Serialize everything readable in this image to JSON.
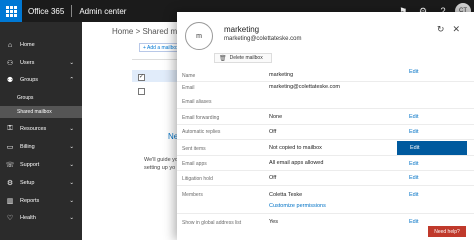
{
  "topbar": {
    "brand": "Office 365",
    "title": "Admin center",
    "icons": [
      "bell-icon",
      "gear-icon",
      "help-icon"
    ],
    "avatar_initials": "CT"
  },
  "sidebar": {
    "items": [
      {
        "icon": "home-icon",
        "glyph": "⌂",
        "label": "Home",
        "chevron": ""
      },
      {
        "icon": "users-icon",
        "glyph": "⚇",
        "label": "Users",
        "chevron": "⌄"
      },
      {
        "icon": "groups-icon",
        "glyph": "⚉",
        "label": "Groups",
        "chevron": "⌃"
      },
      {
        "icon": "resources-icon",
        "glyph": "⚿",
        "label": "Resources",
        "chevron": "⌄"
      },
      {
        "icon": "billing-icon",
        "glyph": "▭",
        "label": "Billing",
        "chevron": "⌄"
      },
      {
        "icon": "support-icon",
        "glyph": "☏",
        "label": "Support",
        "chevron": "⌄"
      },
      {
        "icon": "setup-icon",
        "glyph": "⚙",
        "label": "Setup",
        "chevron": "⌄"
      },
      {
        "icon": "reports-icon",
        "glyph": "▥",
        "label": "Reports",
        "chevron": "⌄"
      },
      {
        "icon": "health-icon",
        "glyph": "♡",
        "label": "Health",
        "chevron": "⌄"
      }
    ],
    "sub_items": [
      {
        "label": "Groups",
        "active": false
      },
      {
        "label": "Shared mailbox",
        "active": true
      }
    ]
  },
  "main": {
    "breadcrumb": "Home > Shared mai",
    "add_button": "+ Add a mailbox",
    "empty_title": "Ne",
    "empty_body": "We'll guide yo setting up yo"
  },
  "panel": {
    "avatar_initials": "m",
    "name": "marketing",
    "email": "marketing@colettateske.com",
    "delete_label": "Delete mailbox",
    "fields": [
      {
        "label": "Name",
        "value": "marketing",
        "edit": "Edit"
      },
      {
        "label": "Email",
        "value": "marketing@colettateske.com",
        "edit": ""
      },
      {
        "label": "Email aliases",
        "value": "",
        "edit": ""
      },
      {
        "label": "Email forwarding",
        "value": "None",
        "edit": "Edit"
      },
      {
        "label": "Automatic replies",
        "value": "Off",
        "edit": "Edit"
      },
      {
        "label": "Sent items",
        "value": "Not copied to mailbox",
        "edit": "Edit"
      },
      {
        "label": "Email apps",
        "value": "All email apps allowed",
        "edit": "Edit"
      },
      {
        "label": "Litigation hold",
        "value": "Off",
        "edit": "Edit"
      },
      {
        "label": "Members",
        "value": "Coletta Teske",
        "value2": "Customize permissions",
        "edit": "Edit"
      },
      {
        "label": "Show in global address list",
        "value": "Yes",
        "edit": "Edit"
      }
    ]
  },
  "help": {
    "label": "Need help?"
  },
  "colors": {
    "accent": "#0078d4",
    "highlight_edit": "#005a9e",
    "help": "#c0392b"
  }
}
